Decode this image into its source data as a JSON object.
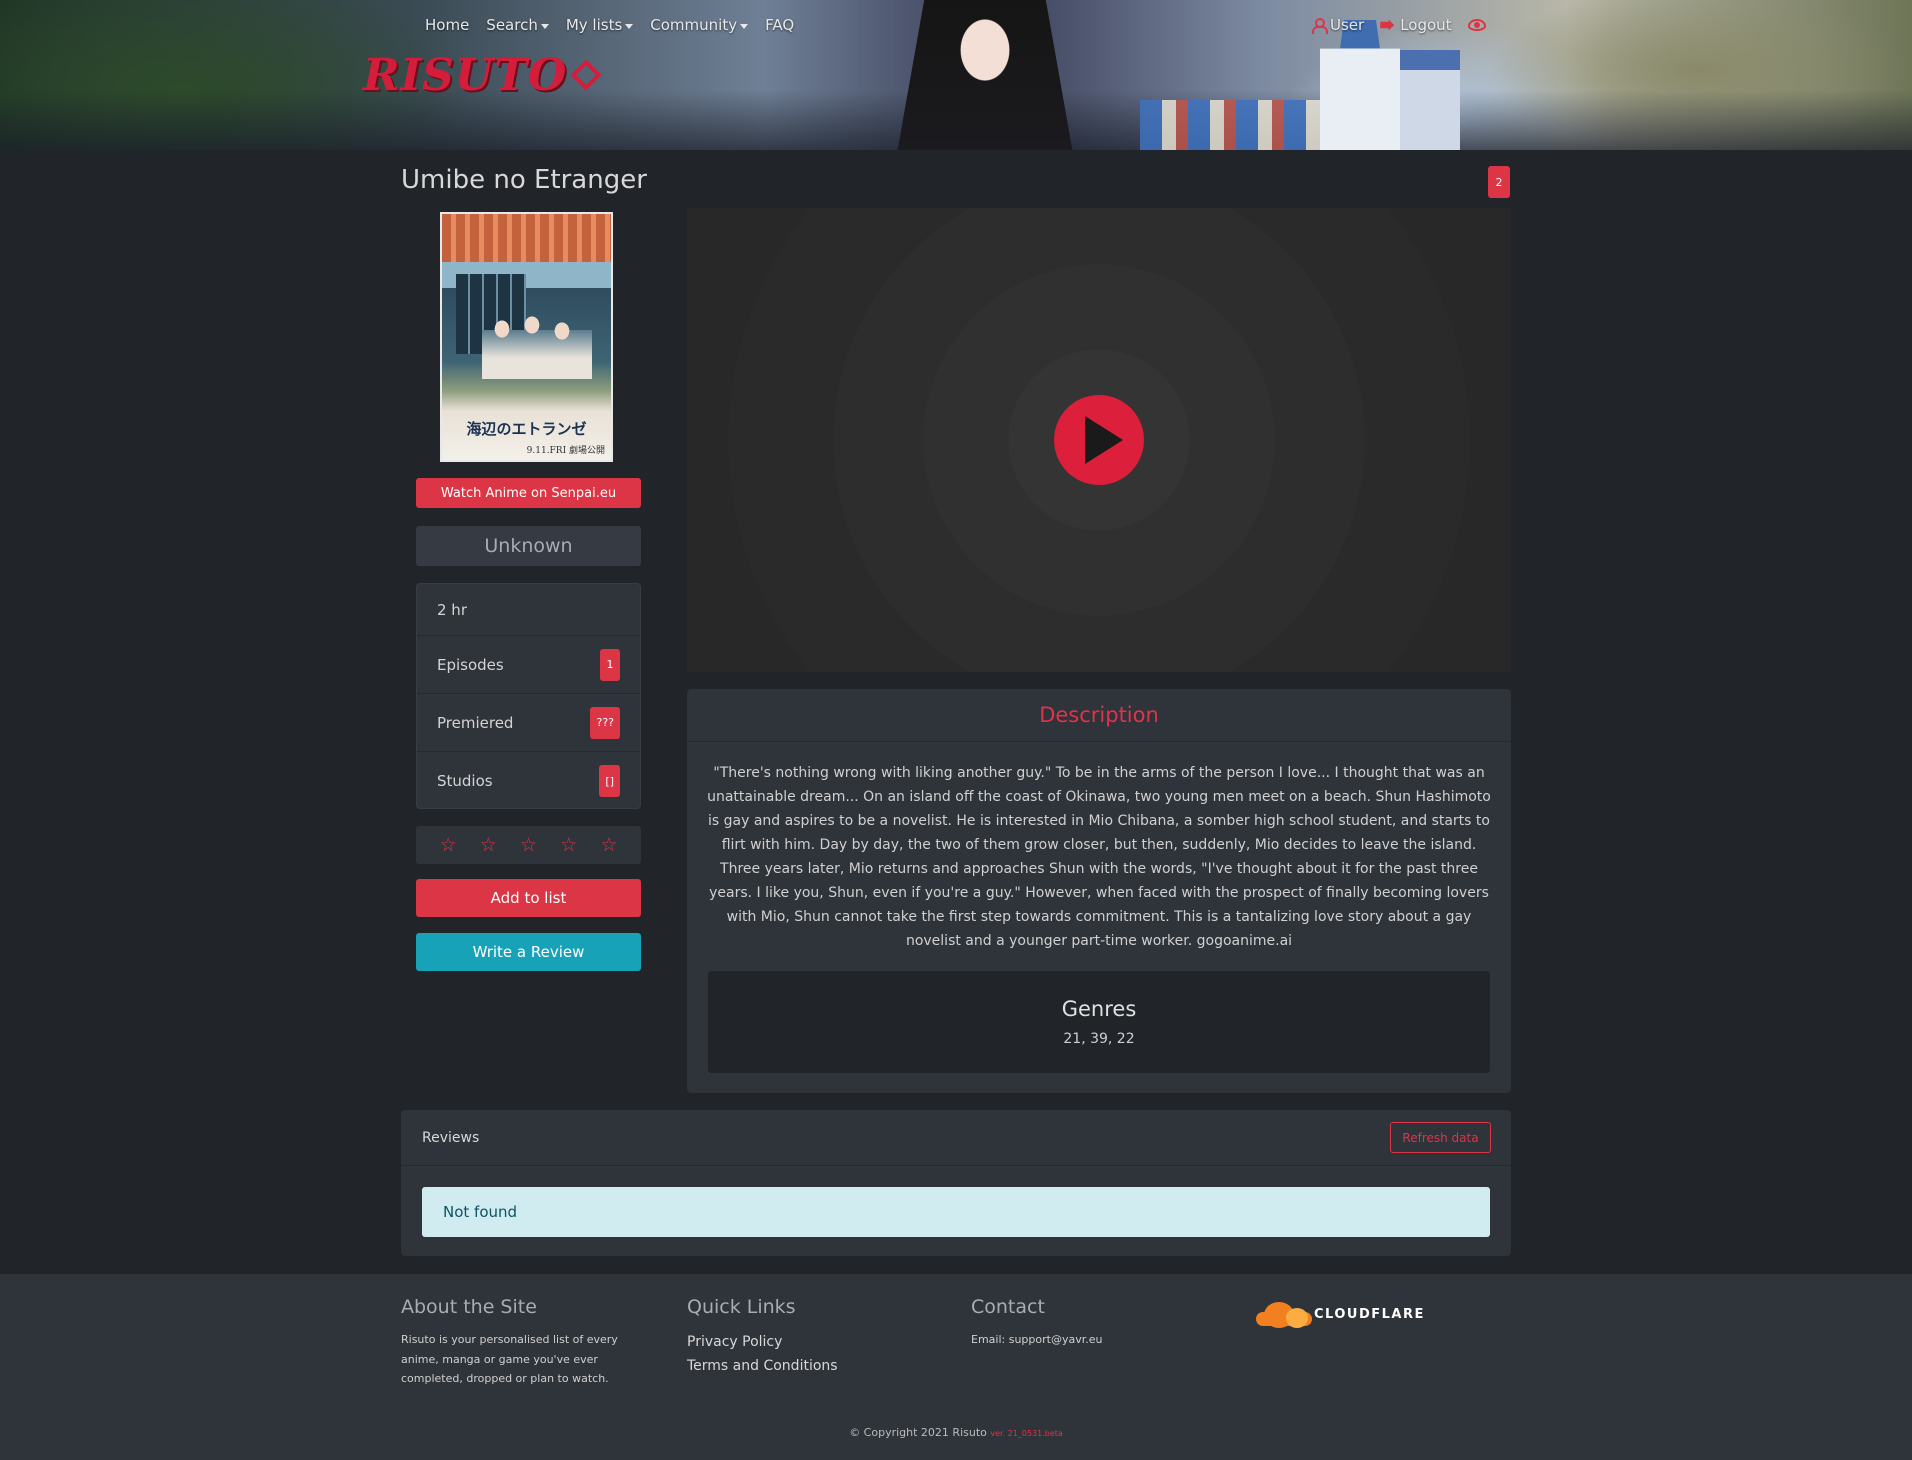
{
  "nav": {
    "items": [
      {
        "label": "Home",
        "dropdown": false
      },
      {
        "label": "Search",
        "dropdown": true
      },
      {
        "label": "My lists",
        "dropdown": true
      },
      {
        "label": "Community",
        "dropdown": true
      },
      {
        "label": "FAQ",
        "dropdown": false
      }
    ],
    "logo_text": "RISUTO",
    "user_label": "User",
    "logout_label": "Logout"
  },
  "anime": {
    "title": "Umibe no Etranger",
    "count_badge": "2",
    "poster_title": "海辺のエトランゼ",
    "poster_date": "9.11.FRI 劇場公開",
    "watch_button": "Watch Anime on Senpai.eu",
    "status": "Unknown",
    "info": [
      {
        "label": "2 hr",
        "value": ""
      },
      {
        "label": "Episodes",
        "value": "1"
      },
      {
        "label": "Premiered",
        "value": "???"
      },
      {
        "label": "Studios",
        "value": "[]"
      }
    ],
    "stars": [
      "☆",
      "☆",
      "☆",
      "☆",
      "☆"
    ],
    "add_to_list": "Add to list",
    "write_review": "Write a Review"
  },
  "description": {
    "heading": "Description",
    "text": "\"There's nothing wrong with liking another guy.\" To be in the arms of the person I love... I thought that was an unattainable dream... On an island off the coast of Okinawa, two young men meet on a beach. Shun Hashimoto is gay and aspires to be a novelist. He is interested in Mio Chibana, a somber high school student, and starts to flirt with him. Day by day, the two of them grow closer, but then, suddenly, Mio decides to leave the island. Three years later, Mio returns and approaches Shun with the words, \"I've thought about it for the past three years. I like you, Shun, even if you're a guy.\" However, when faced with the prospect of finally becoming lovers with Mio, Shun cannot take the first step towards commitment. This is a tantalizing love story about a gay novelist and a younger part-time worker. gogoanime.ai",
    "genres_heading": "Genres",
    "genres_value": "21, 39, 22"
  },
  "reviews": {
    "heading": "Reviews",
    "refresh_button": "Refresh data",
    "empty_message": "Not found"
  },
  "footer": {
    "about_title": "About the Site",
    "about_text": "Risuto is your personalised list of every anime, manga or game you've ever completed, dropped or plan to watch.",
    "links_title": "Quick Links",
    "links": [
      "Privacy Policy",
      "Terms and Conditions"
    ],
    "contact_title": "Contact",
    "contact_text": "Email: support@yavr.eu",
    "cloudflare_text": "CLOUDFLARE",
    "copyright": "© Copyright 2021 Risuto",
    "version": "ver. 21_0531.beta"
  },
  "colors": {
    "accent": "#dc3545",
    "info": "#17a2b8",
    "background": "#212429",
    "card": "#2f333a"
  }
}
